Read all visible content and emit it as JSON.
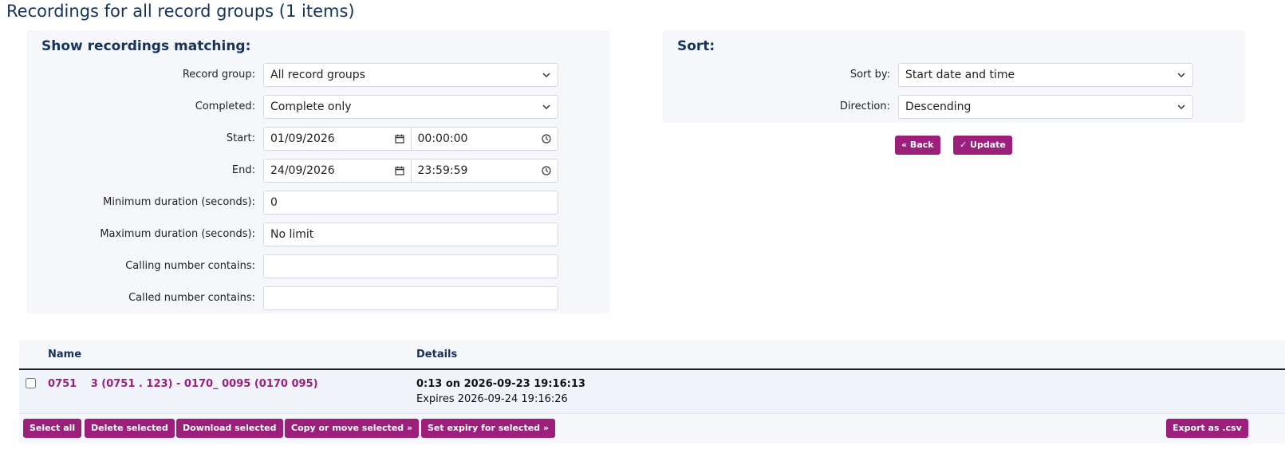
{
  "page": {
    "title": "Recordings for all record groups (1 items)"
  },
  "filter": {
    "heading": "Show recordings matching:",
    "record_group": {
      "label": "Record group:",
      "value": "All record groups"
    },
    "completed": {
      "label": "Completed:",
      "value": "Complete only"
    },
    "start": {
      "label": "Start:",
      "date": "01/09/2026",
      "time": "00:00:00"
    },
    "end": {
      "label": "End:",
      "date": "24/09/2026",
      "time": "23:59:59"
    },
    "min_duration": {
      "label": "Minimum duration (seconds):",
      "value": "0"
    },
    "max_duration": {
      "label": "Maximum duration (seconds):",
      "value": "No limit"
    },
    "calling_number": {
      "label": "Calling number contains:",
      "value": ""
    },
    "called_number": {
      "label": "Called number contains:",
      "value": ""
    }
  },
  "sort": {
    "heading": "Sort:",
    "sort_by": {
      "label": "Sort by:",
      "value": "Start date and time"
    },
    "direction": {
      "label": "Direction:",
      "value": "Descending"
    }
  },
  "actions": {
    "back": "« Back",
    "update": "✓ Update"
  },
  "results": {
    "columns": {
      "name": "Name",
      "details": "Details"
    },
    "rows": [
      {
        "name": "0751  3 (0751 . 123) - 0170_ 0095 (0170 095)",
        "details_main": "0:13 on 2026-09-23 19:16:13",
        "details_sub": "Expires 2026-09-24 19:16:26"
      }
    ]
  },
  "footer": {
    "select_all": "Select all",
    "delete_selected": "Delete selected",
    "download_selected": "Download selected",
    "copy_move_selected": "Copy or move selected »",
    "set_expiry_selected": "Set expiry for selected »",
    "export_csv": "Export as .csv"
  },
  "icons": {
    "dropdown": "chevron-down-icon",
    "date": "calendar-icon",
    "time": "clock-icon"
  },
  "colors": {
    "accent": "#9c1f7c",
    "heading": "#16335c",
    "panel": "#f5f7fb"
  }
}
